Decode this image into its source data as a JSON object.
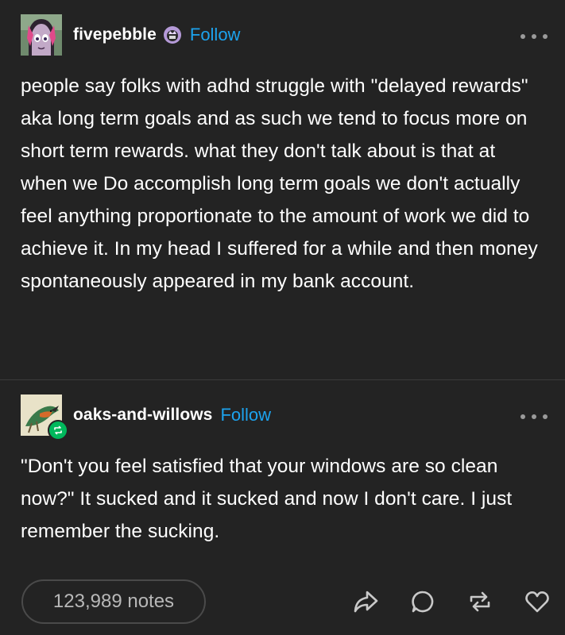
{
  "post1": {
    "username": "fivepebble",
    "follow_label": "Follow",
    "text": "people say folks with adhd struggle with \"delayed rewards\" aka long term goals and as such we tend to focus more on short term rewards. what they don't talk about is that at when we Do accomplish long term goals we don't actually feel anything proportionate to the amount of work we did to achieve it. In my head I suffered for a while and then money spontaneously appeared in my bank account."
  },
  "post2": {
    "username": "oaks-and-willows",
    "follow_label": "Follow",
    "text": "\"Don't you feel satisfied that your windows are so clean now?\" It sucked and it sucked and now I don't care. I just remember the sucking."
  },
  "footer": {
    "notes": "123,989 notes",
    "actions": [
      "share-icon",
      "comment-icon",
      "reblog-icon",
      "heart-icon"
    ]
  },
  "colors": {
    "background": "#232323",
    "follow": "#1ca3ee",
    "reblog_badge": "#00b85c"
  }
}
